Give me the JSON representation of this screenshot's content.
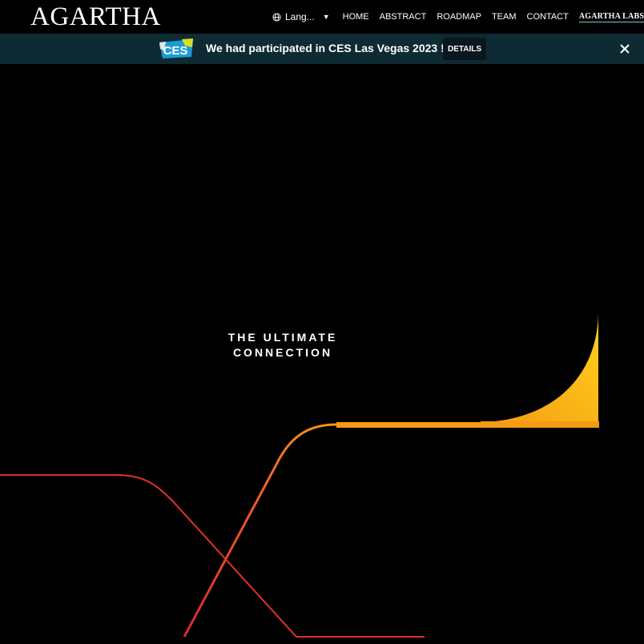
{
  "header": {
    "logo_text": "AGARTHA",
    "language_label": "Lang...",
    "nav": [
      {
        "label": "HOME"
      },
      {
        "label": "ABSTRACT"
      },
      {
        "label": "ROADMAP"
      },
      {
        "label": "TEAM"
      },
      {
        "label": "CONTACT"
      }
    ],
    "labs_label": "AGARTHA LABS"
  },
  "banner": {
    "logo_text": "CES",
    "message": "We had participated in CES Las Vegas 2023 !",
    "details_label": "DETAILS"
  },
  "hero": {
    "headline_line1": "THE ULTIMATE",
    "headline_line2": "CONNECTION"
  },
  "colors": {
    "background": "#000000",
    "banner_background": "#0e2a33",
    "line_red": "#e0302a",
    "line_orange": "#f28a1f",
    "line_yellow": "#ffd21a",
    "line_teal": "#7fb8c8"
  },
  "icons": {
    "language": "globe-icon",
    "dropdown": "caret-down-icon",
    "close": "close-icon"
  }
}
